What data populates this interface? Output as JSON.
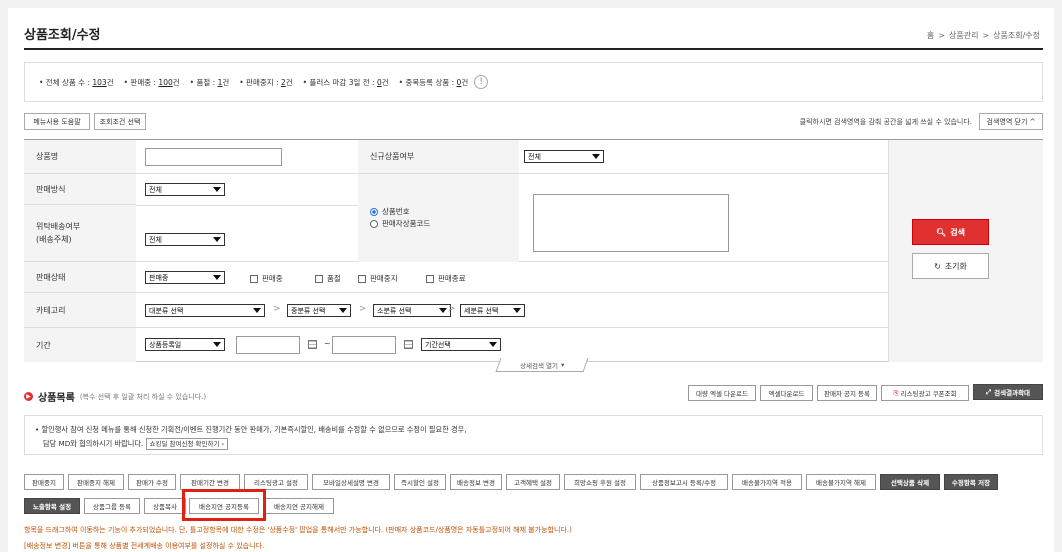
{
  "page_title": "상품조회/수정",
  "breadcrumb": [
    "홈",
    "상품관리",
    "상품조회/수정"
  ],
  "breadcrumb_sep": ">",
  "summary": [
    {
      "label": "• 전체 상품 수 : ",
      "value": "103",
      "unit": "건"
    },
    {
      "label": "• 판매중 : ",
      "value": "100",
      "unit": "건"
    },
    {
      "label": "• 품절 : ",
      "value": "1",
      "unit": "건"
    },
    {
      "label": "• 판매중지 : ",
      "value": "2",
      "unit": "건"
    },
    {
      "label": "• 플러스 마감 3일 전 : ",
      "value": "0",
      "unit": "건"
    },
    {
      "label": "• 중복등록 상품 : ",
      "value": "0",
      "unit": "건"
    }
  ],
  "toolbar": {
    "help": "메뉴사용 도움말",
    "cond": "조회조건 선택",
    "hint": "클릭하시면 검색영역을 감춰 공간을 넓게 쓰실 수 있습니다.",
    "collapse": "검색영역 닫기 ^"
  },
  "form": {
    "product_name": "상품명",
    "new_product": "신규상품여부",
    "new_product_value": "전체",
    "sale_method": "판매방식",
    "sale_method_value": "전체",
    "consign_1": "위탁배송여부",
    "consign_2": "(배송주체)",
    "consign_value": "전체",
    "radio_product_no": "상품번호",
    "radio_seller_code": "판매자상품코드",
    "status": "판매상태",
    "status_value": "판매중",
    "status_checks": [
      "판매중",
      "품절",
      "판매중지",
      "판매종료"
    ],
    "category": "카테고리",
    "cat_large": "대분류 선택",
    "cat_mid": "중분류 선택",
    "cat_small": "소분류 선택",
    "cat_detail": "세분류 선택",
    "period": "기간",
    "period_type": "상품등록일",
    "period_sep": "~",
    "period_select": "기간선택"
  },
  "search_button": "검색",
  "reset_button": "초기화",
  "more_search": "상세검색 열기",
  "list": {
    "title": "상품목록",
    "subtitle": "(복수 선택 후 일괄 처리 하실 수 있습니다.)",
    "downloads": [
      "대량 엑셀 다운로드",
      "엑셀다운로드",
      "판매자 공지 등록",
      "리스팅광고 쿠폰조회",
      "검색결과확대"
    ]
  },
  "notice_line1": "• 할인행사 참여 신청 메뉴를 통해 신청한 기획전/이벤트 진행기간 동안 판매가, 기본즉시할인, 배송비를 수정할 수 없으므로 수정이 필요한 경우,",
  "notice_line2": "담당 MD와 협의하시기 바랍니다.",
  "notice_btn": "쇼킹딜 참여신청 확인하기",
  "actions_row1": [
    "판매중지",
    "판매중지 해제",
    "판매가 수정",
    "판매기간 변경",
    "리스팅광고 설정",
    "모바일상세설명 변경",
    "즉시할인 설정",
    "배송정보 변경",
    "고객혜택 설정",
    "희망쇼핑 후원 설정",
    "상품정보고시 등록/수정",
    "배송불가지역 적용",
    "배송불가지역 해제",
    "선택상품 삭제",
    "수정항목 저장"
  ],
  "actions_row2": [
    "노출항목 설정",
    "상품그룹 등록",
    "상품복사",
    "배송지연 공지등록",
    "배송지연 공지해제"
  ],
  "note1": "항목을 드래그하여 이동하는 기능이 추가되었습니다. 단, 틀고정항목에 대한 수정은 '상품수정' 팝업을 통해서만 가능합니다. (판매자 상품코드/상품명은 자동틀고정되어 해제 불가능합니다.)",
  "note2": "[배송정보 변경] 버튼을 통해 상품별 전세계배송 이용여부를 설정하실 수 있습니다.",
  "colors": {
    "accent": "#e03030",
    "highlight": "#e02010"
  }
}
